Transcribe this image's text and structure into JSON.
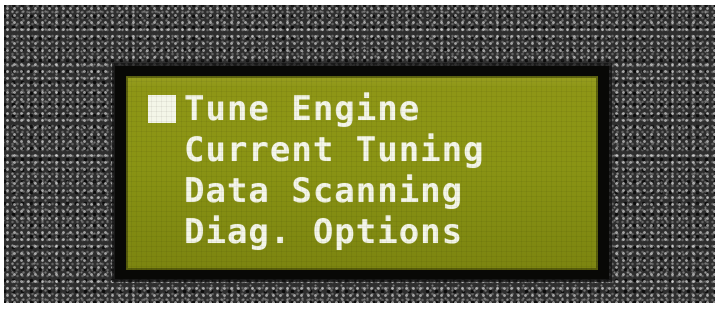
{
  "lcd_menu": {
    "items": [
      {
        "label": "Tune Engine",
        "selected": true
      },
      {
        "label": "Current Tuning",
        "selected": false
      },
      {
        "label": "Data Scanning",
        "selected": false
      },
      {
        "label": "Diag. Options",
        "selected": false
      }
    ],
    "cursor_icon": "selection-block-icon"
  },
  "colors": {
    "lcd_background": "#8a9414",
    "lcd_text": "#f4f6e8",
    "frame": "#080806",
    "bezel": "#2e2e2e"
  }
}
